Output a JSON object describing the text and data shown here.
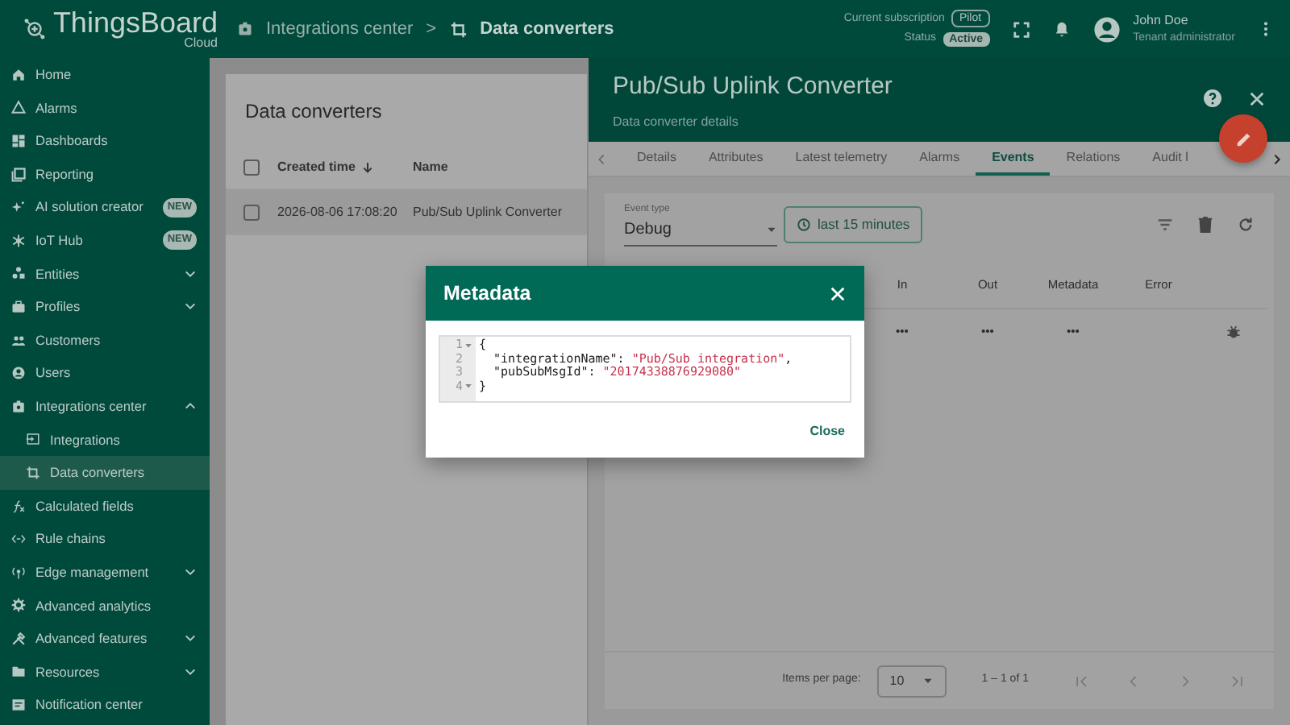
{
  "topbar": {
    "logo": {
      "name": "ThingsBoard",
      "edition": "Cloud"
    },
    "breadcrumb": [
      {
        "label": "Integrations center"
      },
      {
        "label": "Data converters"
      }
    ],
    "breadcrumb_separator": ">",
    "subscription": {
      "label": "Current subscription",
      "value": "Pilot"
    },
    "status": {
      "label": "Status",
      "value": "Active"
    },
    "user": {
      "name": "John Doe",
      "role": "Tenant administrator"
    }
  },
  "sidebar": {
    "items": [
      {
        "label": "Home",
        "kind": "link",
        "selected": false
      },
      {
        "label": "Alarms",
        "kind": "link",
        "selected": false
      },
      {
        "label": "Dashboards",
        "kind": "link",
        "selected": false
      },
      {
        "label": "Reporting",
        "kind": "link",
        "selected": false
      },
      {
        "label": "AI solution creator",
        "kind": "link",
        "selected": false,
        "badge": "NEW"
      },
      {
        "label": "IoT Hub",
        "kind": "link",
        "selected": false,
        "badge": "NEW"
      },
      {
        "label": "Entities",
        "kind": "group",
        "selected": false,
        "expanded": false
      },
      {
        "label": "Profiles",
        "kind": "group",
        "selected": false,
        "expanded": false
      },
      {
        "label": "Customers",
        "kind": "link",
        "selected": false
      },
      {
        "label": "Users",
        "kind": "link",
        "selected": false
      },
      {
        "label": "Integrations center",
        "kind": "group",
        "selected": false,
        "expanded": true,
        "children": [
          {
            "label": "Integrations",
            "selected": false
          },
          {
            "label": "Data converters",
            "selected": true
          }
        ]
      },
      {
        "label": "Calculated fields",
        "kind": "link",
        "selected": false
      },
      {
        "label": "Rule chains",
        "kind": "link",
        "selected": false
      },
      {
        "label": "Edge management",
        "kind": "group",
        "selected": false,
        "expanded": false
      },
      {
        "label": "Advanced analytics",
        "kind": "link",
        "selected": false
      },
      {
        "label": "Advanced features",
        "kind": "group",
        "selected": false,
        "expanded": false
      },
      {
        "label": "Resources",
        "kind": "group",
        "selected": false,
        "expanded": false
      },
      {
        "label": "Notification center",
        "kind": "link",
        "selected": false
      }
    ]
  },
  "list": {
    "title": "Data converters",
    "all_selected": false,
    "columns": [
      "Created time",
      "Name"
    ],
    "rows": [
      {
        "created_time": "2026-08-06 17:08:20",
        "name": "Pub/Sub Uplink Converter",
        "selected": false,
        "highlighted": true
      }
    ]
  },
  "details": {
    "title": "Pub/Sub Uplink Converter",
    "subtitle": "Data converter details",
    "tabs": [
      {
        "label": "Details",
        "selected": false
      },
      {
        "label": "Attributes",
        "selected": false
      },
      {
        "label": "Latest telemetry",
        "selected": false
      },
      {
        "label": "Alarms",
        "selected": false
      },
      {
        "label": "Events",
        "selected": true
      },
      {
        "label": "Relations",
        "selected": false
      },
      {
        "label": "Audit l",
        "selected": false
      }
    ],
    "event_type": {
      "label": "Event type",
      "value": "Debug"
    },
    "time_window": "last 15 minutes",
    "events": {
      "columns": [
        "In",
        "Out",
        "Metadata",
        "Error"
      ],
      "rows": [
        {
          "in": "•••",
          "out": "•••",
          "metadata": "•••"
        }
      ]
    },
    "pagination": {
      "items_per_page_label": "Items per page:",
      "items_per_page": "10",
      "range": "1 – 1 of 1"
    }
  },
  "dialog": {
    "title": "Metadata",
    "lines": [
      {
        "number": "1",
        "foldable": true,
        "tokens": [
          {
            "kind": "plain",
            "text": "{"
          }
        ]
      },
      {
        "number": "2",
        "foldable": false,
        "tokens": [
          {
            "kind": "plain",
            "text": "  \"integrationName\": "
          },
          {
            "kind": "string",
            "text": "\"Pub/Sub integration\""
          },
          {
            "kind": "plain",
            "text": ","
          }
        ]
      },
      {
        "number": "3",
        "foldable": false,
        "tokens": [
          {
            "kind": "plain",
            "text": "  \"pubSubMsgId\": "
          },
          {
            "kind": "string",
            "text": "\"20174338876929080\""
          }
        ]
      },
      {
        "number": "4",
        "foldable": true,
        "tokens": [
          {
            "kind": "plain",
            "text": "}"
          }
        ]
      }
    ],
    "button": "Close"
  }
}
